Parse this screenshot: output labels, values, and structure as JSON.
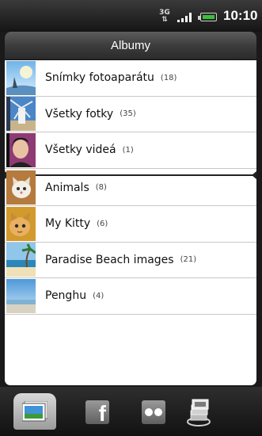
{
  "status_bar": {
    "network_type": "3G",
    "time": "10:10"
  },
  "header": {
    "title": "Albumy"
  },
  "albums": [
    {
      "name": "Snímky fotoaparátu",
      "count": "(18)",
      "thumb": "sunset-tree"
    },
    {
      "name": "Všetky fotky",
      "count": "(35)",
      "thumb": "windmill"
    },
    {
      "name": "Všetky videá",
      "count": "(1)",
      "thumb": "girl-portrait"
    },
    {
      "name": "Animals",
      "count": "(8)",
      "thumb": "kitten"
    },
    {
      "name": "My Kitty",
      "count": "(6)",
      "thumb": "cat"
    },
    {
      "name": "Paradise Beach images",
      "count": "(21)",
      "thumb": "beach"
    },
    {
      "name": "Penghu",
      "count": "(4)",
      "thumb": "seascape"
    }
  ],
  "tabs": [
    {
      "name": "albums-tab",
      "icon": "photos-icon",
      "active": true
    },
    {
      "name": "facebook-tab",
      "icon": "facebook-icon",
      "active": false
    },
    {
      "name": "flickr-tab",
      "icon": "flickr-icon",
      "active": false
    },
    {
      "name": "more-tab",
      "icon": "stack-icon",
      "active": false
    }
  ],
  "colors": {
    "battery": "#39c13a",
    "list_background": "#ffffff",
    "header_background": "#3c3c3c"
  }
}
